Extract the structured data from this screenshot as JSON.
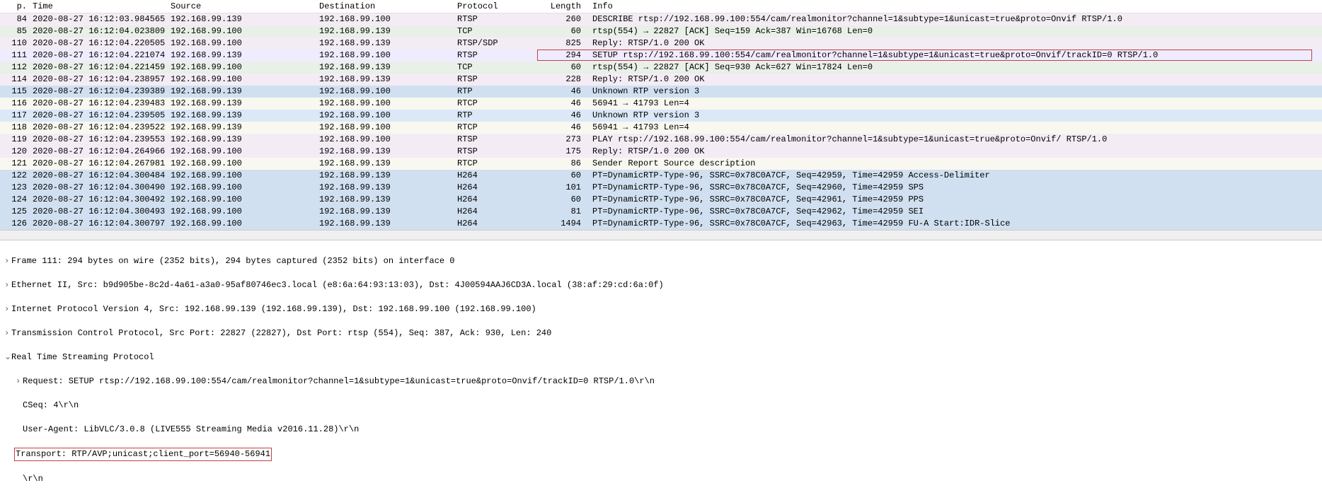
{
  "columns": {
    "no": "p.",
    "time": "Time",
    "source": "Source",
    "destination": "Destination",
    "protocol": "Protocol",
    "length": "Length",
    "info": "Info"
  },
  "packets": [
    {
      "no": "84",
      "time": "2020-08-27 16:12:03.984565",
      "src": "192.168.99.139",
      "dst": "192.168.99.100",
      "proto": "RTSP",
      "len": "260",
      "info": "DESCRIBE rtsp://192.168.99.100:554/cam/realmonitor?channel=1&subtype=1&unicast=true&proto=Onvif RTSP/1.0",
      "cls": "row-pink"
    },
    {
      "no": "85",
      "time": "2020-08-27 16:12:04.023809",
      "src": "192.168.99.100",
      "dst": "192.168.99.139",
      "proto": "TCP",
      "len": "60",
      "info": "rtsp(554) → 22827 [ACK] Seq=159 Ack=387 Win=16768 Len=0",
      "cls": "row-light"
    },
    {
      "no": "110",
      "time": "2020-08-27 16:12:04.220505",
      "src": "192.168.99.100",
      "dst": "192.168.99.139",
      "proto": "RTSP/SDP",
      "len": "825",
      "info": "Reply: RTSP/1.0 200 OK",
      "cls": "row-pink",
      "marker": "✓"
    },
    {
      "no": "111",
      "time": "2020-08-27 16:12:04.221074",
      "src": "192.168.99.139",
      "dst": "192.168.99.100",
      "proto": "RTSP",
      "len": "294",
      "info": "SETUP rtsp://192.168.99.100:554/cam/realmonitor?channel=1&subtype=1&unicast=true&proto=Onvif/trackID=0 RTSP/1.0",
      "cls": "row-highlight",
      "outlined": true
    },
    {
      "no": "112",
      "time": "2020-08-27 16:12:04.221459",
      "src": "192.168.99.100",
      "dst": "192.168.99.139",
      "proto": "TCP",
      "len": "60",
      "info": "rtsp(554) → 22827 [ACK] Seq=930 Ack=627 Win=17824 Len=0",
      "cls": "row-light"
    },
    {
      "no": "114",
      "time": "2020-08-27 16:12:04.238957",
      "src": "192.168.99.100",
      "dst": "192.168.99.139",
      "proto": "RTSP",
      "len": "228",
      "info": "Reply: RTSP/1.0 200 OK",
      "cls": "row-pink"
    },
    {
      "no": "115",
      "time": "2020-08-27 16:12:04.239389",
      "src": "192.168.99.139",
      "dst": "192.168.99.100",
      "proto": "RTP",
      "len": "46",
      "info": "Unknown RTP version 3",
      "cls": "row-blue"
    },
    {
      "no": "116",
      "time": "2020-08-27 16:12:04.239483",
      "src": "192.168.99.139",
      "dst": "192.168.99.100",
      "proto": "RTCP",
      "len": "46",
      "info": "56941 → 41793 Len=4",
      "cls": "row-cream"
    },
    {
      "no": "117",
      "time": "2020-08-27 16:12:04.239505",
      "src": "192.168.99.139",
      "dst": "192.168.99.100",
      "proto": "RTP",
      "len": "46",
      "info": "Unknown RTP version 3",
      "cls": "row-blue2"
    },
    {
      "no": "118",
      "time": "2020-08-27 16:12:04.239522",
      "src": "192.168.99.139",
      "dst": "192.168.99.100",
      "proto": "RTCP",
      "len": "46",
      "info": "56941 → 41793 Len=4",
      "cls": "row-cream"
    },
    {
      "no": "119",
      "time": "2020-08-27 16:12:04.239553",
      "src": "192.168.99.139",
      "dst": "192.168.99.100",
      "proto": "RTSP",
      "len": "273",
      "info": "PLAY rtsp://192.168.99.100:554/cam/realmonitor?channel=1&subtype=1&unicast=true&proto=Onvif/ RTSP/1.0",
      "cls": "row-pink"
    },
    {
      "no": "120",
      "time": "2020-08-27 16:12:04.264966",
      "src": "192.168.99.100",
      "dst": "192.168.99.139",
      "proto": "RTSP",
      "len": "175",
      "info": "Reply: RTSP/1.0 200 OK",
      "cls": "row-pink"
    },
    {
      "no": "121",
      "time": "2020-08-27 16:12:04.267981",
      "src": "192.168.99.100",
      "dst": "192.168.99.139",
      "proto": "RTCP",
      "len": "86",
      "info": "Sender Report   Source description",
      "cls": "row-cream"
    },
    {
      "no": "122",
      "time": "2020-08-27 16:12:04.300484",
      "src": "192.168.99.100",
      "dst": "192.168.99.139",
      "proto": "H264",
      "len": "60",
      "info": "PT=DynamicRTP-Type-96, SSRC=0x78C0A7CF, Seq=42959, Time=42959 Access-Delimiter",
      "cls": "row-blue"
    },
    {
      "no": "123",
      "time": "2020-08-27 16:12:04.300490",
      "src": "192.168.99.100",
      "dst": "192.168.99.139",
      "proto": "H264",
      "len": "101",
      "info": "PT=DynamicRTP-Type-96, SSRC=0x78C0A7CF, Seq=42960, Time=42959 SPS",
      "cls": "row-blue"
    },
    {
      "no": "124",
      "time": "2020-08-27 16:12:04.300492",
      "src": "192.168.99.100",
      "dst": "192.168.99.139",
      "proto": "H264",
      "len": "60",
      "info": "PT=DynamicRTP-Type-96, SSRC=0x78C0A7CF, Seq=42961, Time=42959 PPS",
      "cls": "row-blue"
    },
    {
      "no": "125",
      "time": "2020-08-27 16:12:04.300493",
      "src": "192.168.99.100",
      "dst": "192.168.99.139",
      "proto": "H264",
      "len": "81",
      "info": "PT=DynamicRTP-Type-96, SSRC=0x78C0A7CF, Seq=42962, Time=42959 SEI",
      "cls": "row-blue"
    },
    {
      "no": "126",
      "time": "2020-08-27 16:12:04.300797",
      "src": "192.168.99.100",
      "dst": "192.168.99.139",
      "proto": "H264",
      "len": "1494",
      "info": "PT=DynamicRTP-Type-96, SSRC=0x78C0A7CF, Seq=42963, Time=42959 FU-A Start:IDR-Slice",
      "cls": "row-blue"
    }
  ],
  "details": {
    "frame": "Frame 111: 294 bytes on wire (2352 bits), 294 bytes captured (2352 bits) on interface 0",
    "eth": "Ethernet II, Src: b9d905be-8c2d-4a61-a3a0-95af80746ec3.local (e8:6a:64:93:13:03), Dst: 4J00594AAJ6CD3A.local (38:af:29:cd:6a:0f)",
    "ip": "Internet Protocol Version 4, Src: 192.168.99.139 (192.168.99.139), Dst: 192.168.99.100 (192.168.99.100)",
    "tcp": "Transmission Control Protocol, Src Port: 22827 (22827), Dst Port: rtsp (554), Seq: 387, Ack: 930, Len: 240",
    "rtsp": "Real Time Streaming Protocol",
    "request": "Request: SETUP rtsp://192.168.99.100:554/cam/realmonitor?channel=1&subtype=1&unicast=true&proto=Onvif/trackID=0 RTSP/1.0\\r\\n",
    "cseq": "CSeq: 4\\r\\n",
    "ua": "User-Agent: LibVLC/3.0.8 (LIVE555 Streaming Media v2016.11.28)\\r\\n",
    "transport": "Transport: RTP/AVP;unicast;client_port=56940-56941",
    "tail": "\\r\\n"
  }
}
